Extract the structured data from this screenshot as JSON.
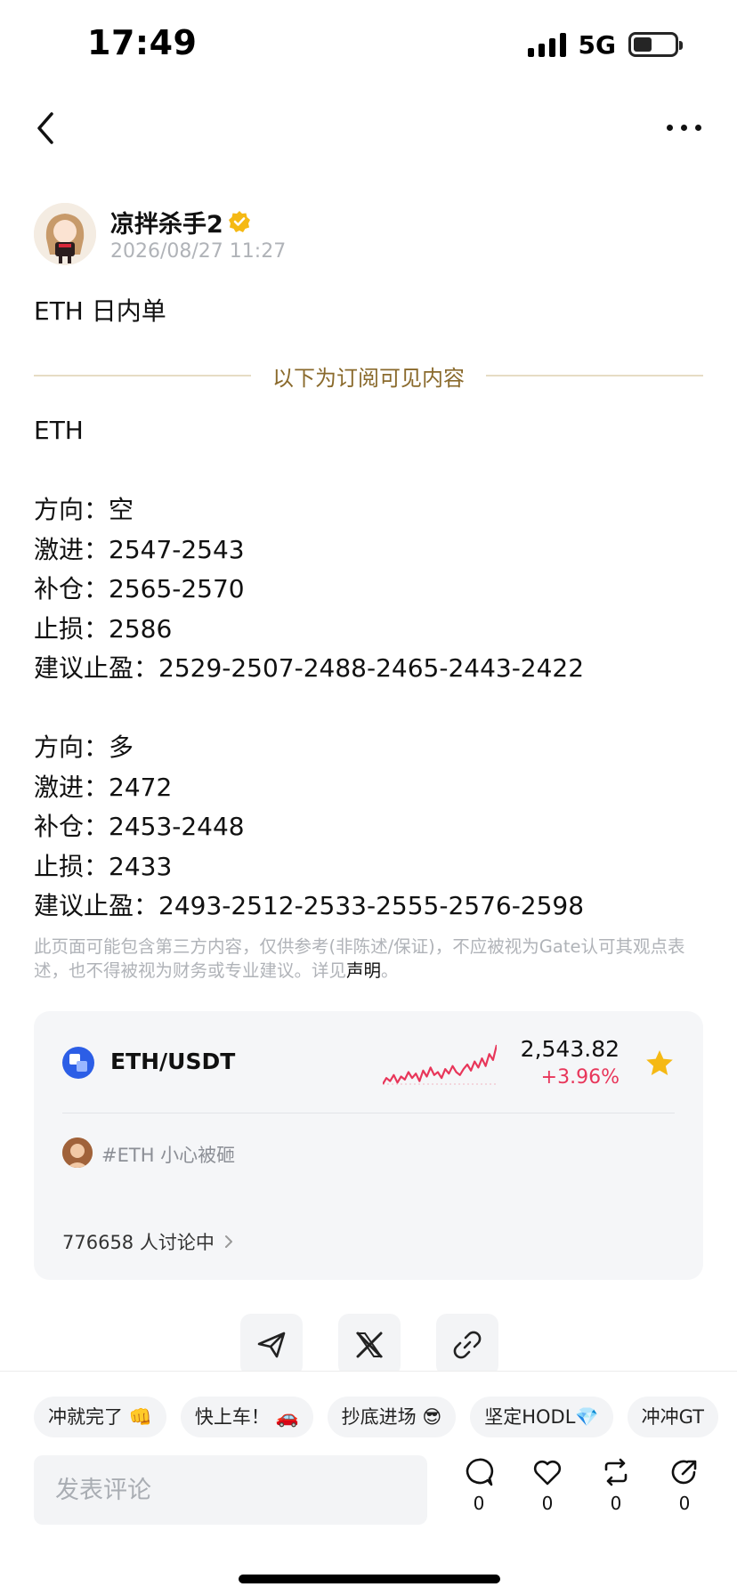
{
  "status_bar": {
    "time": "17:49",
    "network": "5G",
    "battery_level": 0.45
  },
  "nav": {
    "back_icon": "chevron-left-icon",
    "more_icon": "more-horizontal-icon"
  },
  "author": {
    "name": "凉拌杀手2",
    "verified": true,
    "date": "2026/08/27 11:27"
  },
  "post": {
    "title": "ETH 日内单",
    "subscription_divider": "以下为订阅可见内容",
    "lines": [
      "ETH",
      "",
      "方向：空",
      "激进：2547-2543",
      "补仓：2565-2570",
      "止损：2586",
      "建议止盈：2529-2507-2488-2465-2443-2422",
      "",
      "方向：多",
      "激进：2472",
      "补仓：2453-2448",
      "止损：2433",
      "建议止盈：2493-2512-2533-2555-2576-2598"
    ],
    "disclaimer": "此页面可能包含第三方内容，仅供参考(非陈述/保证)，不应被视为Gate认可其观点表述，也不得被视为财务或专业建议。详见",
    "disclaimer_link": "声明",
    "disclaimer_end": "。"
  },
  "market": {
    "pair": "ETH/USDT",
    "price": "2,543.82",
    "change": "+3.96%",
    "change_color": "#e8365a",
    "favorite": true,
    "sparkline": [
      18,
      22,
      20,
      24,
      19,
      23,
      21,
      26,
      22,
      25,
      20,
      27,
      23,
      29,
      24,
      26,
      22,
      28,
      25,
      30,
      26,
      24,
      28,
      31,
      27,
      33,
      29,
      35,
      30,
      38,
      34,
      44
    ]
  },
  "topic": {
    "text": "#ETH 小心被砸",
    "discussing": "776658 人讨论中"
  },
  "share": {
    "icons": [
      "send-icon",
      "x-icon",
      "link-icon"
    ]
  },
  "quick_replies": [
    "冲就完了 👊",
    "快上车！ 🚗",
    "抄底进场 😎",
    "坚定HODL💎",
    "冲冲GT"
  ],
  "comment": {
    "placeholder": "发表评论"
  },
  "actions": [
    {
      "name": "comment",
      "count": "0"
    },
    {
      "name": "like",
      "count": "0"
    },
    {
      "name": "repost",
      "count": "0"
    },
    {
      "name": "share",
      "count": "0"
    }
  ]
}
